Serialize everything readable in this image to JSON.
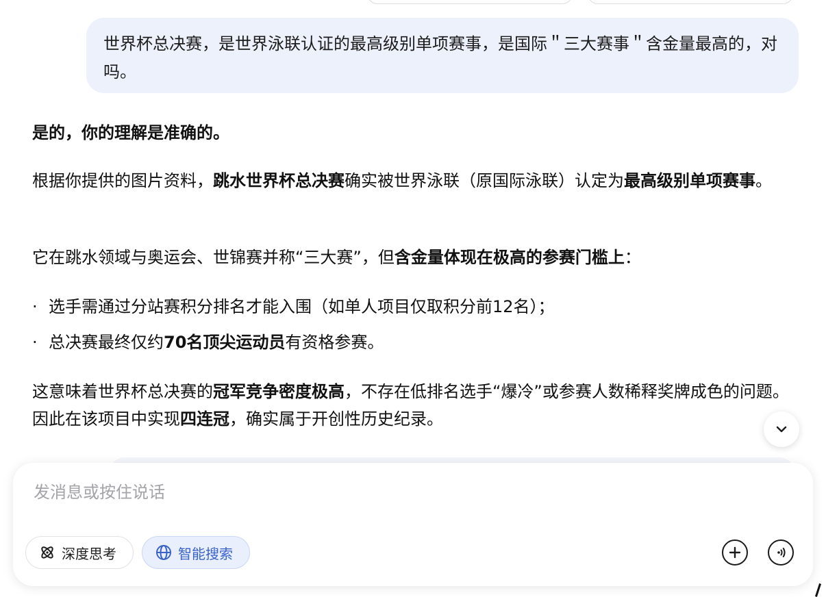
{
  "user_message": "世界杯总决赛，是世界泳联认证的最高级别单项赛事，是国际＂三大赛事＂含金量最高的，对吗。",
  "answer": {
    "intro": "是的，你的理解是准确的。",
    "p2": {
      "a": "根据你提供的图片资料，",
      "b": "跳水世界杯总决赛",
      "c": "确实被世界泳联（原国际泳联）认定为",
      "d": "最高级别单项赛事",
      "e": "。"
    },
    "p3": {
      "a": "它在跳水领域与奥运会、世锦赛并称“三大赛”，但",
      "b": "含金量体现在极高的参赛门槛上",
      "c": "："
    },
    "bullets": [
      {
        "marker": "·",
        "text": "选手需通过分站赛积分排名才能入围（如单人项目仅取积分前12名）；"
      },
      {
        "marker": "·",
        "text_a": "总决赛最终仅约",
        "text_b": "70名顶尖运动员",
        "text_c": "有资格参赛。"
      }
    ],
    "p4": {
      "a": "这意味着世界杯总决赛的",
      "b": "冠军竞争密度极高",
      "c": "，不存在低排名选手“爆冷”或参赛人数稀释奖牌成色的问题。因此在该项目中实现",
      "d": "四连冠",
      "e": "，确实属于开创性历史纪录。"
    }
  },
  "composer": {
    "placeholder": "发消息或按住说话",
    "deep_think_label": "深度思考",
    "smart_search_label": "智能搜索"
  },
  "icons": {
    "scroll_down": "chevron-down-icon",
    "deep_think": "atom-icon",
    "smart_search": "globe-icon",
    "add": "plus-circle-icon",
    "voice": "voice-call-icon"
  },
  "colors": {
    "user_bubble": "#edf1fc",
    "accent": "#3a63c9"
  }
}
